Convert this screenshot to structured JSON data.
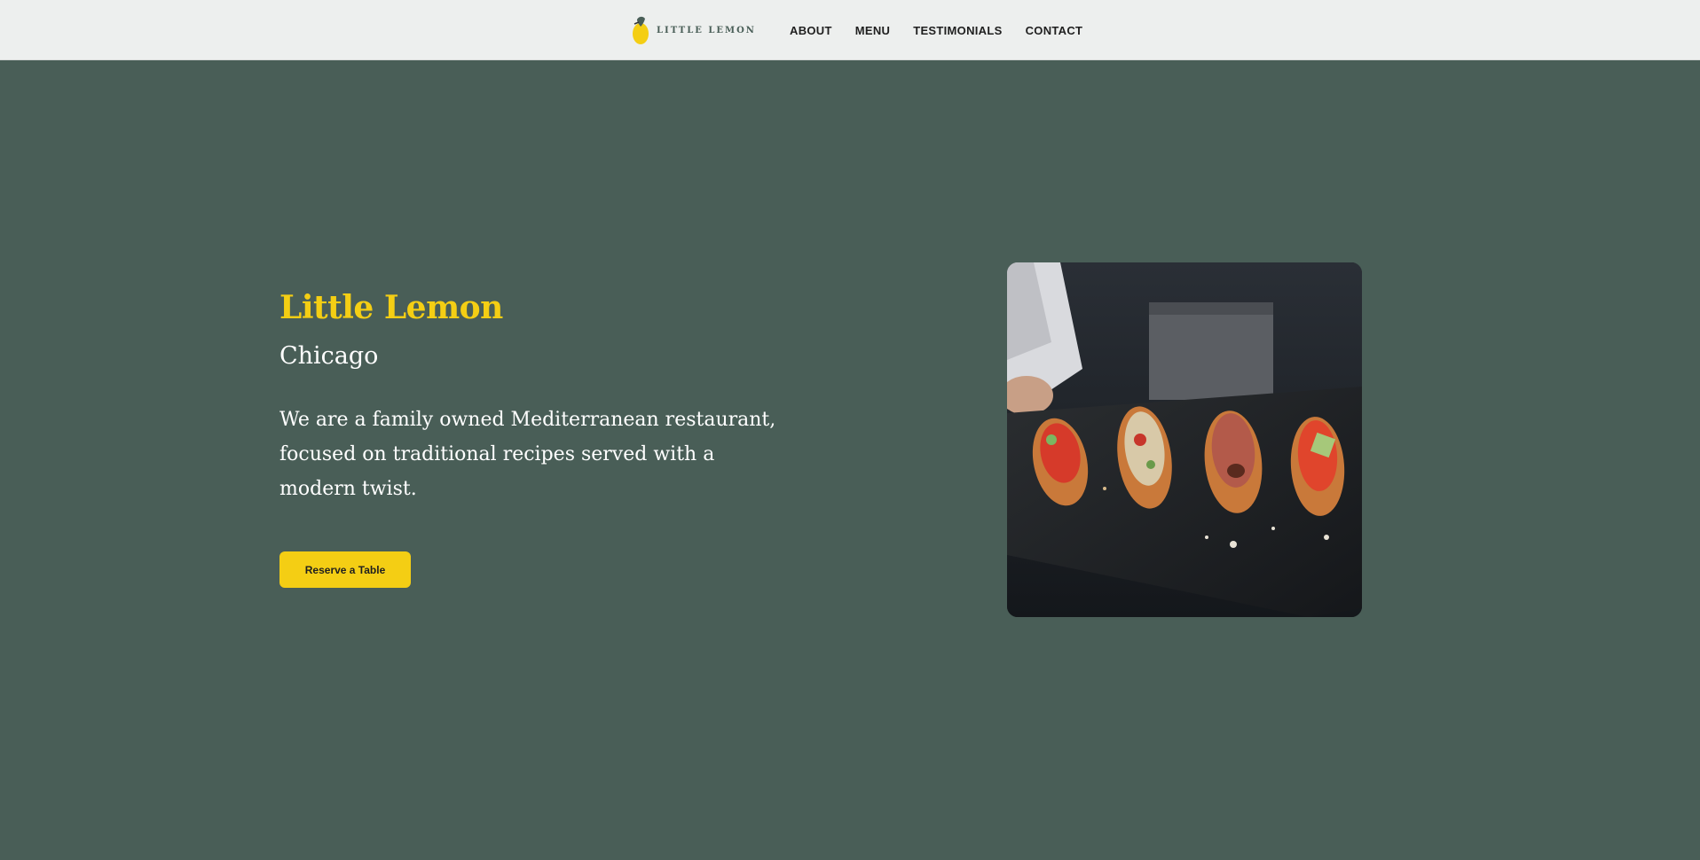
{
  "brand": {
    "name": "LITTLE LEMON",
    "logo_icon": "lemon-icon",
    "accent_color": "#f4ce14",
    "primary_color": "#495e57"
  },
  "nav": {
    "items": [
      {
        "label": "ABOUT"
      },
      {
        "label": "MENU"
      },
      {
        "label": "TESTIMONIALS"
      },
      {
        "label": "CONTACT"
      }
    ]
  },
  "hero": {
    "title": "Little Lemon",
    "subtitle": "Chicago",
    "description": "We are a family owned Mediterranean restaurant, focused on traditional recipes served with a modern twist.",
    "cta_label": "Reserve a Table",
    "image_subject": "bruschetta-photo"
  }
}
